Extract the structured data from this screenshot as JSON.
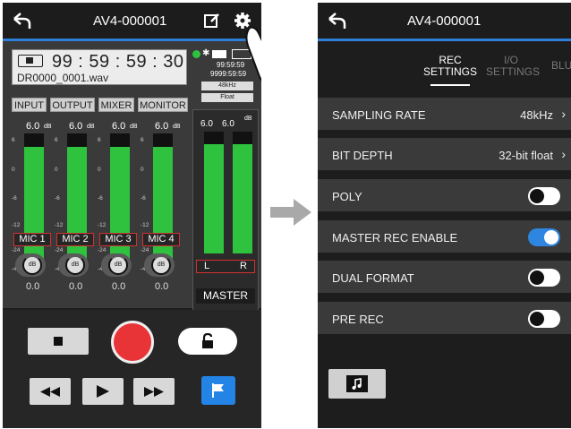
{
  "left_screen": {
    "back_icon": "back-arrow-icon",
    "title": "AV4-000001",
    "edit_icon": "edit-icon",
    "settings_icon": "gear-icon",
    "counter": {
      "time": "99 : 59 : 59 : 30",
      "filename": "DR0000_0001.wav"
    },
    "status": {
      "remain1": "99:59:59",
      "remain2": "9999:59:59",
      "sample_rate": "48kHz",
      "format": "Float"
    },
    "tabs": [
      "INPUT",
      "OUTPUT",
      "MIXER",
      "MONITOR"
    ],
    "channels": [
      {
        "peak": "6.0",
        "unit": "dB",
        "label": "MIC 1",
        "value": "0.0",
        "level": 0.9,
        "auto": "A"
      },
      {
        "peak": "6.0",
        "unit": "dB",
        "label": "MIC 2",
        "value": "0.0",
        "level": 0.9,
        "auto": "A"
      },
      {
        "peak": "6.0",
        "unit": "dB",
        "label": "MIC 3",
        "value": "0.0",
        "level": 0.9,
        "auto": "A"
      },
      {
        "peak": "6.0",
        "unit": "dB",
        "label": "MIC 4",
        "value": "0.0",
        "level": 0.9,
        "auto": "A"
      }
    ],
    "scale_marks": [
      "6",
      "0",
      "-6",
      "-12",
      "-24",
      "-48"
    ],
    "master": {
      "peak_l": "6.0",
      "peak_r": "6.0",
      "unit": "dB",
      "l": "L",
      "r": "R",
      "label": "MASTER",
      "level": 0.9
    },
    "knob_label": "dB",
    "transport": {
      "stop": "stop-icon",
      "record": "record-icon",
      "lock": "unlock-icon",
      "rewind": "rewind-icon",
      "play": "play-icon",
      "forward": "fast-forward-icon",
      "mark": "flag-icon"
    }
  },
  "arrow": "right-arrow-icon",
  "right_screen": {
    "title": "AV4-000001",
    "tabs": [
      {
        "line1": "REC",
        "line2": "SETTINGS",
        "active": true
      },
      {
        "line1": "I/O",
        "line2": "SETTINGS",
        "active": false
      },
      {
        "line1": "BLU",
        "line2": "",
        "active": false
      }
    ],
    "rows": [
      {
        "label": "SAMPLING RATE",
        "value": "48kHz",
        "type": "select"
      },
      {
        "label": "BIT DEPTH",
        "value": "32-bit float",
        "type": "select"
      },
      {
        "label": "POLY",
        "value": "",
        "type": "toggle",
        "on": false
      },
      {
        "label": "MASTER REC ENABLE",
        "value": "",
        "type": "toggle",
        "on": true
      },
      {
        "label": "DUAL FORMAT",
        "value": "",
        "type": "toggle",
        "on": false
      },
      {
        "label": "PRE REC",
        "value": "",
        "type": "toggle",
        "on": false
      }
    ],
    "bottom_icon": "music-file-icon"
  },
  "colors": {
    "accent": "#2f7fd8",
    "meter": "#2ec23f",
    "record": "#e83437",
    "toggle_on": "#2e86e0",
    "channel_border": "#d23030"
  }
}
